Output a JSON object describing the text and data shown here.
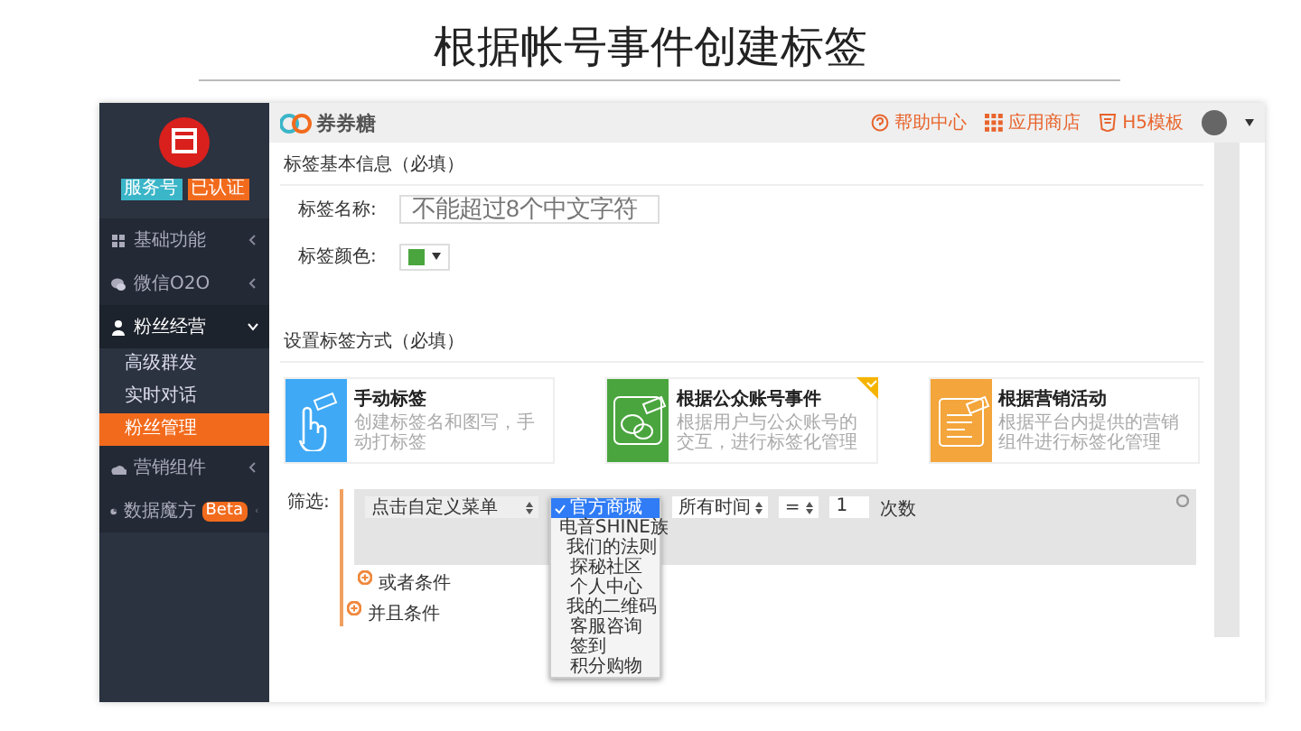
{
  "slide_title": "根据帐号事件创建标签",
  "app": {
    "logo": "券券糖",
    "header_links": [
      {
        "kind": "help",
        "label": "帮助中心"
      },
      {
        "kind": "grid",
        "label": "应用商店"
      },
      {
        "kind": "html5",
        "label": "H5模板"
      }
    ]
  },
  "sidebar": {
    "badges": [
      {
        "label": "服务号",
        "color": "#3bb5c8"
      },
      {
        "label": "已认证",
        "color": "#f26b1d"
      }
    ],
    "items": [
      {
        "kind": "grid",
        "label": "基础功能",
        "expanded": false
      },
      {
        "kind": "chat",
        "label": "微信O2O",
        "expanded": false
      },
      {
        "kind": "people",
        "label": "粉丝经营",
        "expanded": true,
        "children": [
          {
            "label": "高级群发",
            "selected": false
          },
          {
            "label": "实时对话",
            "selected": false
          },
          {
            "label": "粉丝管理",
            "selected": true
          }
        ]
      },
      {
        "kind": "cloud",
        "label": "营销组件",
        "expanded": false
      },
      {
        "kind": "pie",
        "label": "数据魔方",
        "badge": "Beta",
        "expanded": false
      }
    ]
  },
  "basic_info": {
    "title": "标签基本信息（必填）",
    "name_label": "标签名称:",
    "name_placeholder": "不能超过8个中文字符",
    "color_label": "标签颜色:",
    "color": "#4aa53e"
  },
  "method": {
    "title": "设置标签方式（必填）",
    "cards": [
      {
        "kind": "hand",
        "title": "手动标签",
        "desc": "创建标签名和图写，手动打标签",
        "color": "#3fa9f5",
        "selected": false
      },
      {
        "kind": "chat",
        "title": "根据公众账号事件",
        "desc": "根据用户与公众账号的交互，进行标签化管理",
        "color": "#4aa53e",
        "selected": true
      },
      {
        "kind": "doc",
        "title": "根据营销活动",
        "desc": "根据平台内提供的营销组件进行标签化管理",
        "color": "#f4a53b",
        "selected": false
      }
    ]
  },
  "filter": {
    "label": "筛选:",
    "event": "点击自定义菜单",
    "options": [
      {
        "label": "官方商城",
        "selected": true
      },
      {
        "label": "电音SHINE族",
        "selected": false
      },
      {
        "label": "我们的法则",
        "selected": false
      },
      {
        "label": "探秘社区",
        "selected": false
      },
      {
        "label": "个人中心",
        "selected": false
      },
      {
        "label": "我的二维码",
        "selected": false
      },
      {
        "label": "客服咨询",
        "selected": false
      },
      {
        "label": "签到",
        "selected": false
      },
      {
        "label": "积分购物",
        "selected": false
      }
    ],
    "time": "所有时间",
    "operator": "=",
    "count": "1",
    "unit": "次数",
    "or_label": "或者条件",
    "and_label": "并且条件"
  }
}
